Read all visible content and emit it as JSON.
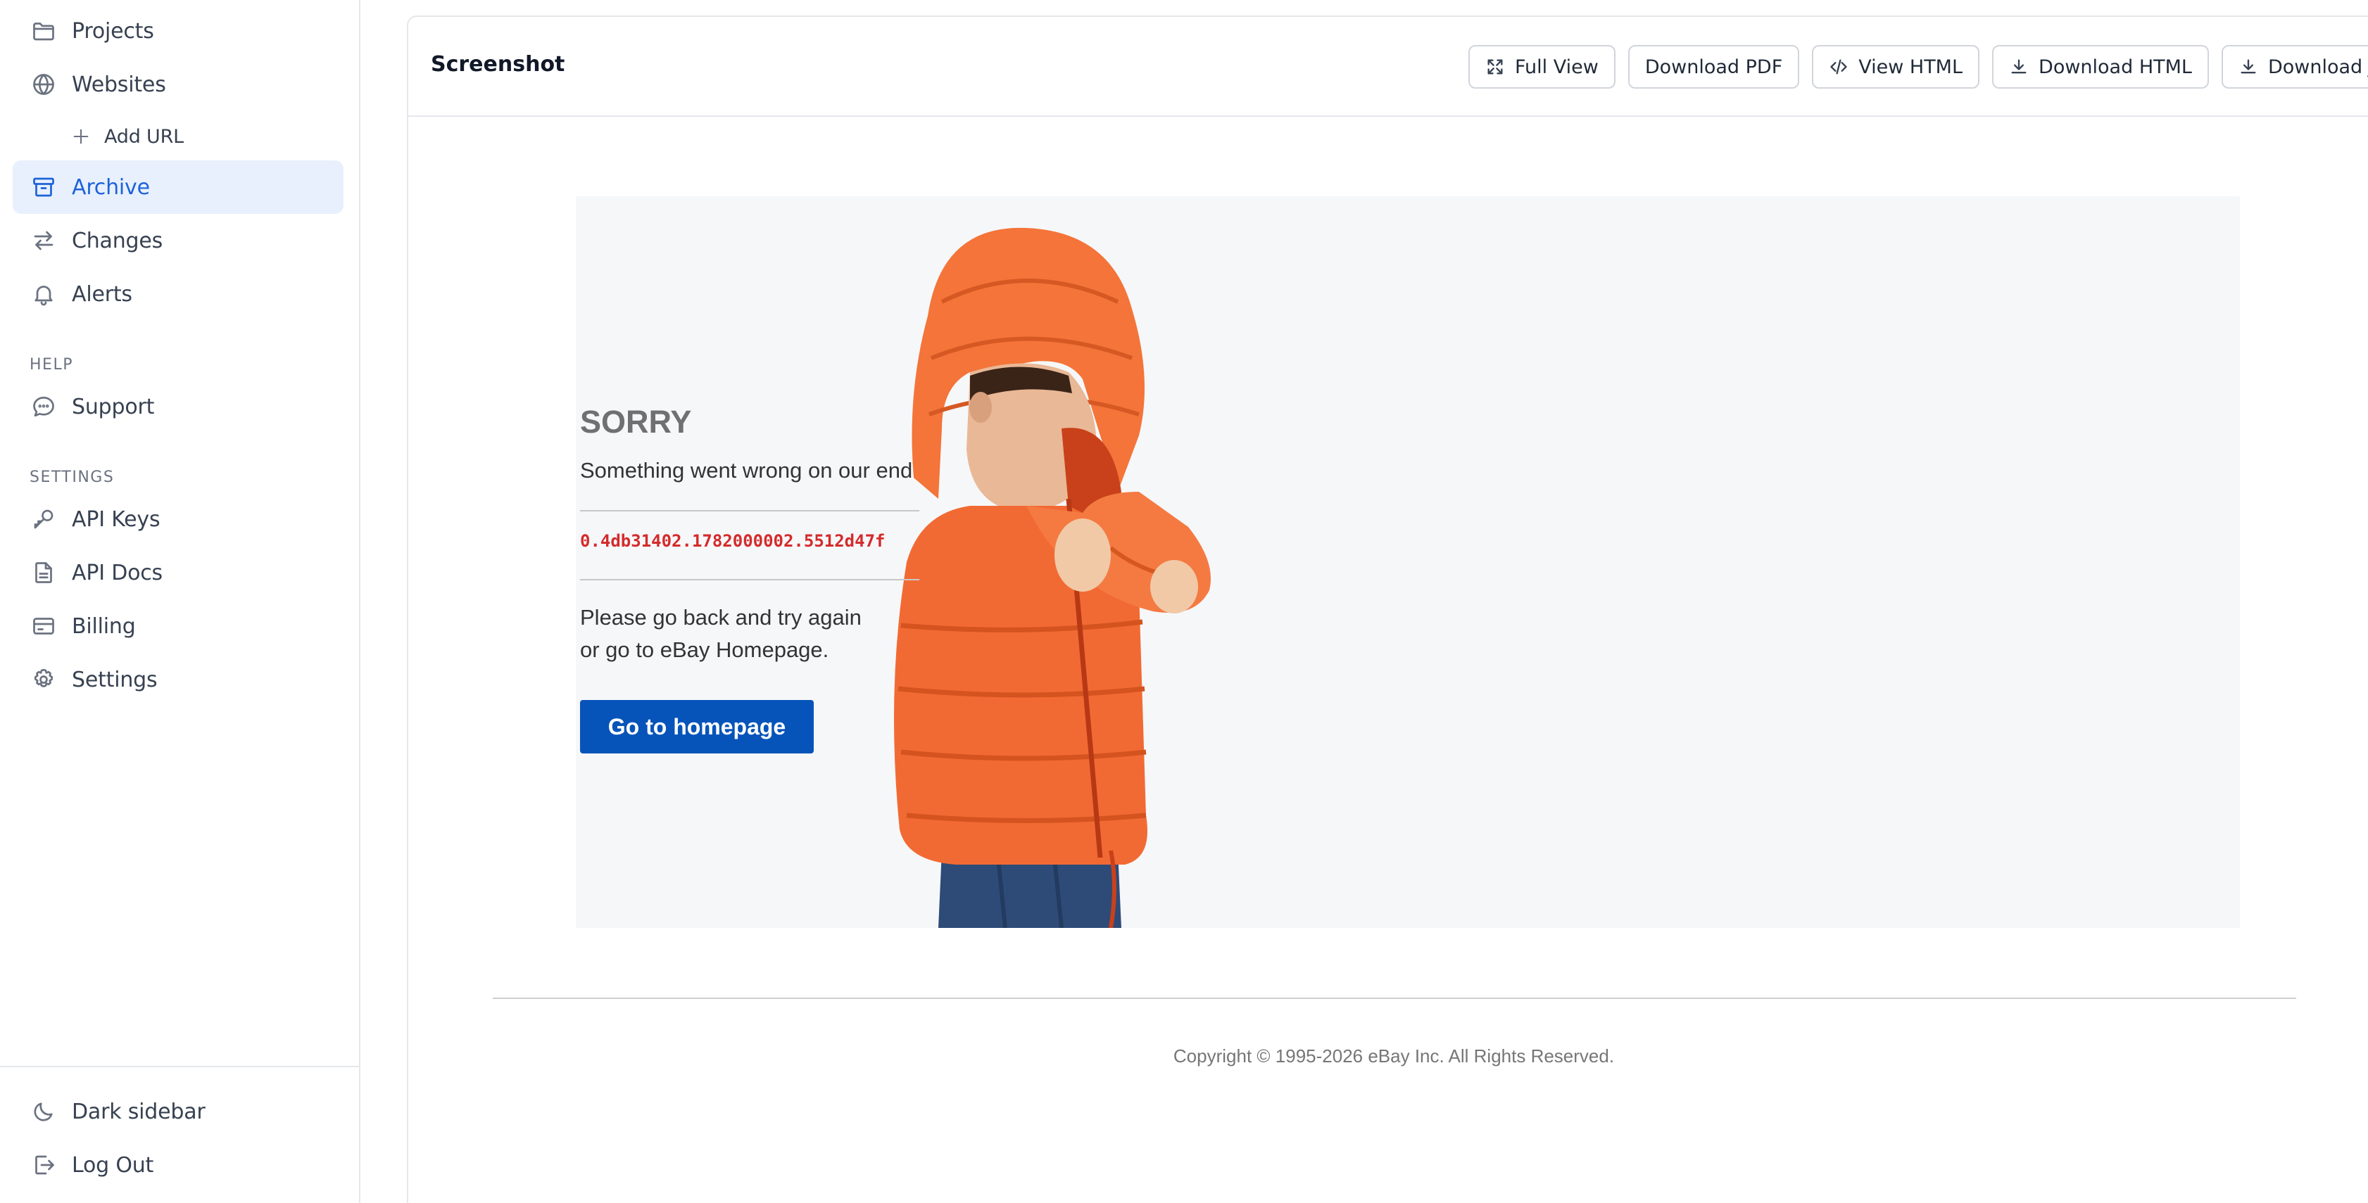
{
  "sidebar": {
    "nav_top": [
      {
        "label": "Projects",
        "icon": "folder-icon"
      },
      {
        "label": "Websites",
        "icon": "globe-icon"
      }
    ],
    "add_url": {
      "label": "Add URL",
      "icon": "plus-icon"
    },
    "nav_main": [
      {
        "label": "Archive",
        "icon": "archive-icon",
        "active": true
      },
      {
        "label": "Changes",
        "icon": "arrows-swap-icon"
      },
      {
        "label": "Alerts",
        "icon": "bell-icon"
      }
    ],
    "help_label": "HELP",
    "support": {
      "label": "Support",
      "icon": "chat-bubble-icon"
    },
    "settings_label": "SETTINGS",
    "settings_items": [
      {
        "label": "API Keys",
        "icon": "key-icon"
      },
      {
        "label": "API Docs",
        "icon": "document-icon"
      },
      {
        "label": "Billing",
        "icon": "credit-card-icon"
      },
      {
        "label": "Settings",
        "icon": "gear-icon"
      }
    ],
    "bottom_items": [
      {
        "label": "Dark sidebar",
        "icon": "moon-icon"
      },
      {
        "label": "Log Out",
        "icon": "logout-icon"
      }
    ],
    "active_color": "#1d63d8",
    "active_bg": "#e8f0fd"
  },
  "panel": {
    "title": "Screenshot",
    "toolbar": {
      "full_view": "Full View",
      "download_pdf": "Download PDF",
      "view_html": "View HTML",
      "download_html": "Download HTML",
      "download_jpg": "Download JPG"
    }
  },
  "captured_page": {
    "title": "SORRY",
    "subtitle": "Something went wrong on our end",
    "error_code": "0.4db31402.1782000002.5512d47f",
    "message_line1": "Please go back and try again",
    "message_line2": "or go to eBay Homepage.",
    "button_label": "Go to homepage",
    "button_color": "#0654ba",
    "error_code_color": "#d42b2b",
    "copyright": "Copyright © 1995-2026 eBay Inc. All Rights Reserved."
  }
}
